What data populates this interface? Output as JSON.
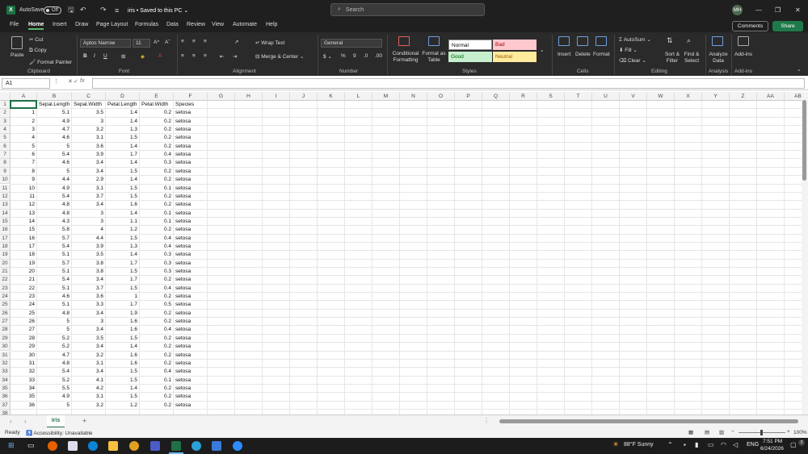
{
  "titlebar": {
    "autosave": "AutoSave",
    "toggle": "Off",
    "filename": "iris • Saved to this PC ⌄",
    "search": "Search",
    "avatar": "MH"
  },
  "menu": [
    "File",
    "Home",
    "Insert",
    "Draw",
    "Page Layout",
    "Formulas",
    "Data",
    "Review",
    "View",
    "Automate",
    "Help"
  ],
  "comments": "Comments",
  "share": "Share",
  "ribbon": {
    "clipboard": {
      "paste": "Paste",
      "cut": "Cut",
      "copy": "Copy",
      "painter": "Format Painter",
      "label": "Clipboard"
    },
    "font": {
      "name": "Aptos Narrow",
      "size": "11",
      "label": "Font"
    },
    "alignment": {
      "wrap": "Wrap Text",
      "merge": "Merge & Center",
      "label": "Alignment"
    },
    "number": {
      "format": "General",
      "label": "Number"
    },
    "styles": {
      "cond": "Conditional Formatting",
      "table": "Format as Table",
      "normal": "Normal",
      "bad": "Bad",
      "good": "Good",
      "neutral": "Neutral",
      "label": "Styles"
    },
    "cells": {
      "insert": "Insert",
      "delete": "Delete",
      "format": "Format",
      "label": "Cells"
    },
    "editing": {
      "autosum": "AutoSum",
      "fill": "Fill",
      "clear": "Clear",
      "sort": "Sort & Filter",
      "find": "Find & Select",
      "label": "Editing"
    },
    "analysis": {
      "analyze": "Analyze Data",
      "label": "Analysis"
    },
    "addins": {
      "addins": "Add-ins",
      "label": "Add-ins"
    }
  },
  "formula": {
    "namebox": "A1",
    "fx": "fx"
  },
  "columns": [
    "A",
    "B",
    "C",
    "D",
    "E",
    "F",
    "G",
    "H",
    "I",
    "J",
    "K",
    "L",
    "M",
    "N",
    "O",
    "P",
    "Q",
    "R",
    "S",
    "T",
    "U",
    "V",
    "W",
    "X",
    "Y",
    "Z",
    "AA",
    "AB"
  ],
  "headers": [
    "",
    "Sepal.Length",
    "Sepal.Width",
    "Petal.Length",
    "Petal.Width",
    "Species"
  ],
  "rows": [
    [
      1,
      5.1,
      3.5,
      1.4,
      0.2,
      "setosa"
    ],
    [
      2,
      4.9,
      3,
      1.4,
      0.2,
      "setosa"
    ],
    [
      3,
      4.7,
      3.2,
      1.3,
      0.2,
      "setosa"
    ],
    [
      4,
      4.6,
      3.1,
      1.5,
      0.2,
      "setosa"
    ],
    [
      5,
      5,
      3.6,
      1.4,
      0.2,
      "setosa"
    ],
    [
      6,
      5.4,
      3.9,
      1.7,
      0.4,
      "setosa"
    ],
    [
      7,
      4.6,
      3.4,
      1.4,
      0.3,
      "setosa"
    ],
    [
      8,
      5,
      3.4,
      1.5,
      0.2,
      "setosa"
    ],
    [
      9,
      4.4,
      2.9,
      1.4,
      0.2,
      "setosa"
    ],
    [
      10,
      4.9,
      3.1,
      1.5,
      0.1,
      "setosa"
    ],
    [
      11,
      5.4,
      3.7,
      1.5,
      0.2,
      "setosa"
    ],
    [
      12,
      4.8,
      3.4,
      1.6,
      0.2,
      "setosa"
    ],
    [
      13,
      4.8,
      3,
      1.4,
      0.1,
      "setosa"
    ],
    [
      14,
      4.3,
      3,
      1.1,
      0.1,
      "setosa"
    ],
    [
      15,
      5.8,
      4,
      1.2,
      0.2,
      "setosa"
    ],
    [
      16,
      5.7,
      4.4,
      1.5,
      0.4,
      "setosa"
    ],
    [
      17,
      5.4,
      3.9,
      1.3,
      0.4,
      "setosa"
    ],
    [
      18,
      5.1,
      3.5,
      1.4,
      0.3,
      "setosa"
    ],
    [
      19,
      5.7,
      3.8,
      1.7,
      0.3,
      "setosa"
    ],
    [
      20,
      5.1,
      3.8,
      1.5,
      0.3,
      "setosa"
    ],
    [
      21,
      5.4,
      3.4,
      1.7,
      0.2,
      "setosa"
    ],
    [
      22,
      5.1,
      3.7,
      1.5,
      0.4,
      "setosa"
    ],
    [
      23,
      4.6,
      3.6,
      1,
      0.2,
      "setosa"
    ],
    [
      24,
      5.1,
      3.3,
      1.7,
      0.5,
      "setosa"
    ],
    [
      25,
      4.8,
      3.4,
      1.9,
      0.2,
      "setosa"
    ],
    [
      26,
      5,
      3,
      1.6,
      0.2,
      "setosa"
    ],
    [
      27,
      5,
      3.4,
      1.6,
      0.4,
      "setosa"
    ],
    [
      28,
      5.2,
      3.5,
      1.5,
      0.2,
      "setosa"
    ],
    [
      29,
      5.2,
      3.4,
      1.4,
      0.2,
      "setosa"
    ],
    [
      30,
      4.7,
      3.2,
      1.6,
      0.2,
      "setosa"
    ],
    [
      31,
      4.8,
      3.1,
      1.6,
      0.2,
      "setosa"
    ],
    [
      32,
      5.4,
      3.4,
      1.5,
      0.4,
      "setosa"
    ],
    [
      33,
      5.2,
      4.1,
      1.5,
      0.1,
      "setosa"
    ],
    [
      34,
      5.5,
      4.2,
      1.4,
      0.2,
      "setosa"
    ],
    [
      35,
      4.9,
      3.1,
      1.5,
      0.2,
      "setosa"
    ],
    [
      36,
      5,
      3.2,
      1.2,
      0.2,
      "setosa"
    ]
  ],
  "sheet": {
    "tab": "iris",
    "add": "+"
  },
  "status": {
    "ready": "Ready",
    "accessibility": "Accessibility: Unavailable",
    "zoom": "100%"
  },
  "taskbar": {
    "weather": "88°F Sunny",
    "lang": "ENG",
    "time": "7:51 PM",
    "date": "6/24/2026",
    "badge": "3"
  }
}
